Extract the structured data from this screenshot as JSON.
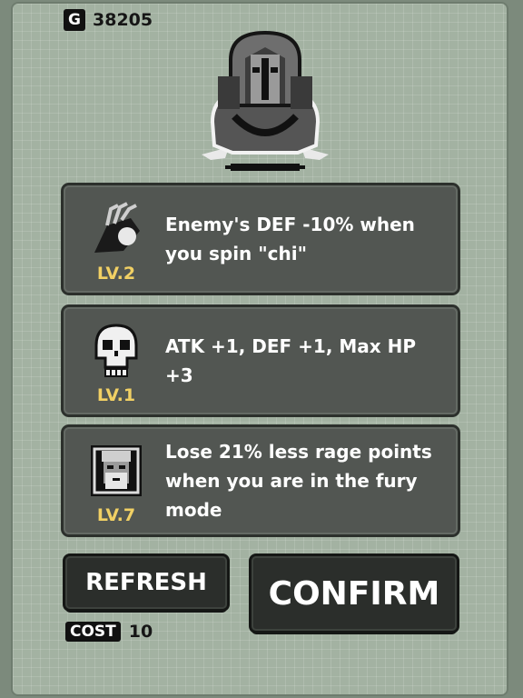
{
  "currency": {
    "icon_letter": "G",
    "amount": "38205",
    "icon": "gold-coin-icon"
  },
  "hero": {
    "icon": "hooded-monk-character-icon"
  },
  "skills": [
    {
      "level": "LV.2",
      "description": "Enemy's DEF -10% when you spin \"chi\"",
      "icon": "claw-hand-icon"
    },
    {
      "level": "LV.1",
      "description": "ATK +1, DEF +1, Max HP +3",
      "icon": "skull-icon"
    },
    {
      "level": "LV.7",
      "description": "Lose 21% less rage points when you are in the fury mode",
      "icon": "bearded-face-icon"
    }
  ],
  "buttons": {
    "refresh": "REFRESH",
    "confirm": "CONFIRM"
  },
  "cost": {
    "label": "COST",
    "value": "10"
  },
  "colors": {
    "background": "#a3b2a2",
    "card": "#525652",
    "level_text": "#f1d064",
    "button": "#2b2e2b"
  }
}
